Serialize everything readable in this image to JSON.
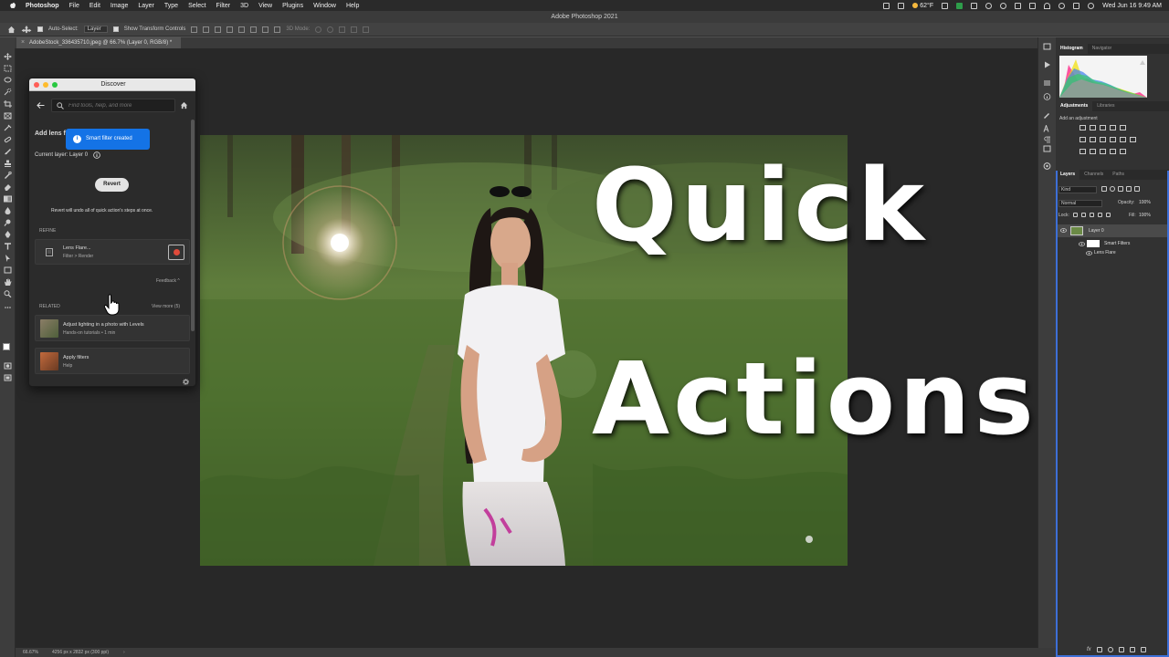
{
  "menubar": {
    "app": "Photoshop",
    "items": [
      "File",
      "Edit",
      "Image",
      "Layer",
      "Type",
      "Select",
      "Filter",
      "3D",
      "View",
      "Plugins",
      "Window",
      "Help"
    ],
    "weather": "62°F",
    "datetime": "Wed Jun 16  9:49 AM"
  },
  "window_title": "Adobe Photoshop 2021",
  "options": {
    "auto_select_label": "Auto-Select:",
    "auto_select_value": "Layer",
    "transform_label": "Show Transform Controls",
    "mode_label": "3D Mode:"
  },
  "document": {
    "tab_label": "AdobeStock_336435710.jpeg @ 66.7% (Layer 0, RGB/8) *",
    "zoom": "66.67%",
    "size": "4256 px x 2832 px (300 ppi)"
  },
  "overlay": {
    "line1": "Quick",
    "line2": "Actions"
  },
  "discover": {
    "title": "Discover",
    "search_placeholder": "Find tools, help, and more",
    "heading": "Add lens fl",
    "toast": "Smart filter created",
    "current_layer": "Current layer: Layer 0",
    "revert_label": "Revert",
    "revert_note": "Revert will undo all of quick action's steps at once.",
    "refine_label": "REFINE",
    "refine_item": {
      "title": "Lens Flare...",
      "sub": "Filter > Render"
    },
    "feedback": "Feedback ^",
    "related_label": "RELATED",
    "view_more": "View more (5)",
    "related": [
      {
        "title": "Adjust lighting in a photo with Levels",
        "sub": "Hands-on tutorials • 1 min"
      },
      {
        "title": "Apply filters",
        "sub": "Help"
      }
    ]
  },
  "panels": {
    "top_tabs": [
      "Histogram",
      "Navigator"
    ],
    "adj_tabs": [
      "Adjustments",
      "Libraries"
    ],
    "adj_hint": "Add an adjustment",
    "layer_tabs": [
      "Layers",
      "Channels",
      "Paths"
    ],
    "kind": "Kind",
    "blend": "Normal",
    "opacity_label": "Opacity:",
    "opacity": "100%",
    "lock_label": "Lock:",
    "fill_label": "Fill:",
    "fill": "100%",
    "layers": [
      {
        "name": "Layer 0"
      },
      {
        "name": "Smart Filters"
      },
      {
        "name": "Lens Flare"
      }
    ]
  },
  "colors": {
    "accent_blue": "#1473e6",
    "panel_border_blue": "#3d6fd6"
  }
}
